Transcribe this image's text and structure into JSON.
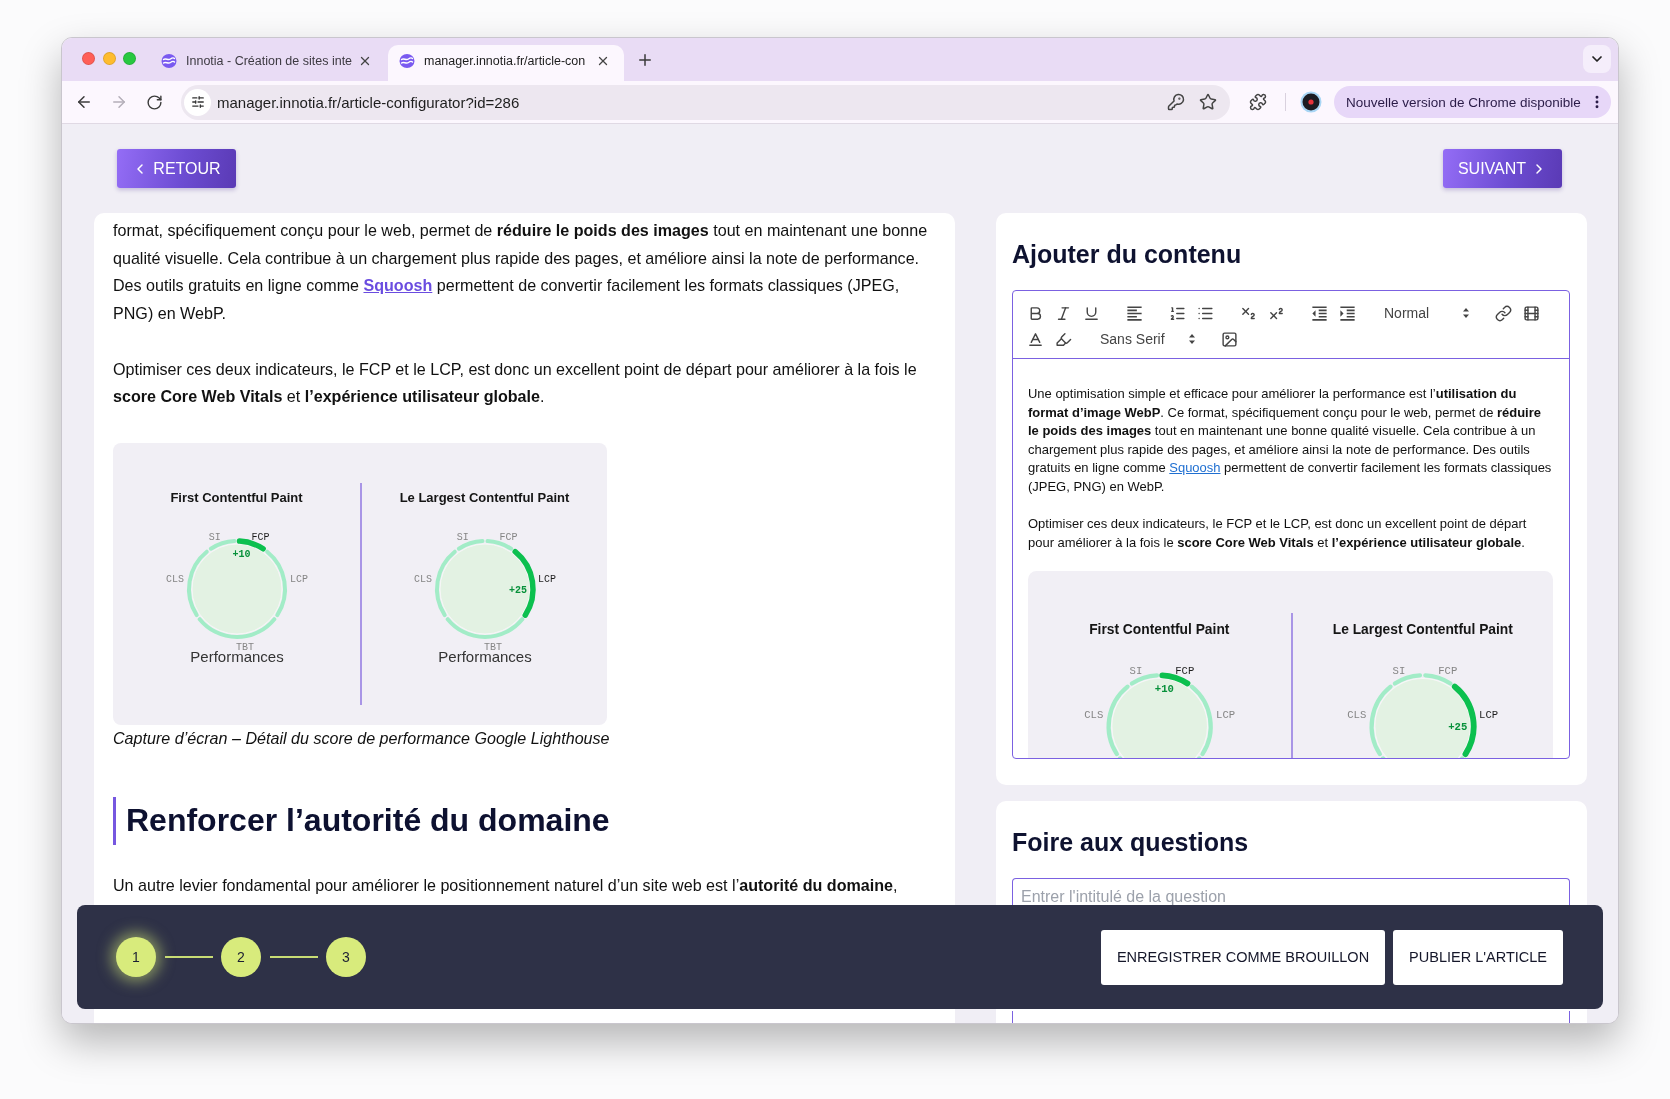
{
  "browser": {
    "tabs": [
      {
        "title": "Innotia - Création de sites inte",
        "selected": false
      },
      {
        "title": "manager.innotia.fr/article-con",
        "selected": true
      }
    ],
    "back": {
      "disabled": false
    },
    "forward": {
      "disabled": true
    },
    "url": "manager.innotia.fr/article-configurator?id=286",
    "update_button": "Nouvelle version de Chrome disponible"
  },
  "nav": {
    "back_button": "RETOUR",
    "next_button": "SUIVANT"
  },
  "article": {
    "blocks": [
      {
        "kind": "paragraph",
        "parts": [
          {
            "kind": "text",
            "text": "format, spécifiquement conçu pour le web, permet de **réduire le poids des images** tout en maintenant une bonne qualité visuelle. Cela contribue à un chargement plus rapide des pages, et améliore ainsi la note de performance. Des outils gratuits en ligne comme "
          },
          {
            "kind": "link",
            "text": "Squoosh"
          },
          {
            "kind": "text",
            "text": " permettent de convertir facilement les formats classiques (JPEG, PNG) en WebP."
          }
        ]
      },
      {
        "kind": "paragraph",
        "parts": [
          {
            "kind": "text",
            "text": "Optimiser ces deux indicateurs, le FCP et le LCP, est donc un excellent point de départ pour améliorer à la fois le **score Core Web Vitals** et **l’expérience utilisateur globale**."
          }
        ]
      },
      {
        "kind": "figure",
        "gauges": [
          {
            "title": "First Contentful Paint",
            "labels": [
              {
                "kind": "northwest",
                "text": "SI",
                "selected": false
              },
              {
                "kind": "northeast",
                "text": "FCP",
                "selected": true
              },
              {
                "kind": "west",
                "text": "CLS",
                "selected": false
              },
              {
                "kind": "east",
                "text": "LCP",
                "selected": false
              },
              {
                "kind": "south",
                "text": "TBT",
                "selected": false
              }
            ],
            "delta": "+10",
            "caption": "Performances"
          },
          {
            "title": "Le Largest Contentful Paint",
            "labels": [
              {
                "kind": "northwest",
                "text": "SI",
                "selected": false
              },
              {
                "kind": "northeast",
                "text": "FCP",
                "selected": false
              },
              {
                "kind": "west",
                "text": "CLS",
                "selected": false
              },
              {
                "kind": "east",
                "text": "LCP",
                "selected": true
              },
              {
                "kind": "south",
                "text": "TBT",
                "selected": false
              }
            ],
            "delta": "+25",
            "caption": "Performances"
          }
        ],
        "caption": "Capture d’écran – Détail du score de performance Google Lighthouse"
      },
      {
        "kind": "heading",
        "text": "Renforcer l’autorité du domaine"
      },
      {
        "kind": "paragraph",
        "parts": [
          {
            "kind": "text",
            "text": "Un autre levier fondamental pour améliorer le positionnement naturel d’un site web est l’**autorité du domaine**,"
          }
        ]
      }
    ]
  },
  "content_editor": {
    "title": "Ajouter du contenu",
    "toolbar": {
      "header_picker": "Normal",
      "font_picker": "Sans Serif"
    },
    "blocks": [
      {
        "kind": "paragraph",
        "parts": [
          {
            "kind": "text",
            "text": "Une optimisation simple et efficace pour améliorer la performance est l’**utilisation du format d’image WebP**. Ce format, spécifiquement conçu pour le web, permet de **réduire le poids des images** tout en maintenant une bonne qualité visuelle. Cela contribue à un chargement plus rapide des pages, et améliore ainsi la note de performance. Des outils gratuits en ligne comme "
          },
          {
            "kind": "link",
            "text": "Squoosh"
          },
          {
            "kind": "text",
            "text": " permettent de convertir facilement les formats classiques (JPEG, PNG) en WebP."
          }
        ]
      },
      {
        "kind": "paragraph",
        "parts": [
          {
            "kind": "text",
            "text": "Optimiser ces deux indicateurs, le FCP et le LCP, est donc un excellent point de départ pour améliorer à la fois le **score Core Web Vitals** et **l’expérience utilisateur globale**."
          }
        ]
      },
      {
        "kind": "figure",
        "gauges": [
          {
            "title": "First Contentful Paint",
            "labels": [
              {
                "kind": "northwest",
                "text": "SI",
                "selected": false
              },
              {
                "kind": "northeast",
                "text": "FCP",
                "selected": true
              },
              {
                "kind": "west",
                "text": "CLS",
                "selected": false
              },
              {
                "kind": "east",
                "text": "LCP",
                "selected": false
              }
            ],
            "delta": "+10"
          },
          {
            "title": "Le Largest Contentful Paint",
            "labels": [
              {
                "kind": "northwest",
                "text": "SI",
                "selected": false
              },
              {
                "kind": "northeast",
                "text": "FCP",
                "selected": false
              },
              {
                "kind": "west",
                "text": "CLS",
                "selected": false
              },
              {
                "kind": "east",
                "text": "LCP",
                "selected": true
              }
            ],
            "delta": "+25"
          }
        ]
      }
    ]
  },
  "faq": {
    "title": "Foire aux questions",
    "question_placeholder": "Entrer l'intitulé de la question"
  },
  "footer": {
    "steps": [
      {
        "label": "1",
        "selected": true
      },
      {
        "label": "2",
        "selected": false
      },
      {
        "label": "3",
        "selected": false
      }
    ],
    "buttons": [
      "ENREGISTRER COMME BROUILLON",
      "PUBLIER L'ARTICLE"
    ]
  }
}
